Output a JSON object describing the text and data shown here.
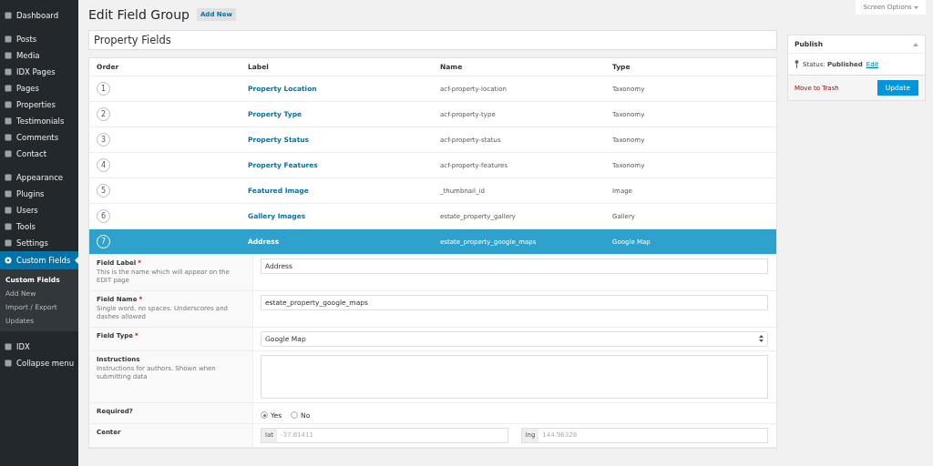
{
  "sidebar": {
    "groups": [
      [
        {
          "label": "Dashboard",
          "selected": false
        }
      ],
      [
        {
          "label": "Posts",
          "selected": false
        },
        {
          "label": "Media",
          "selected": false
        },
        {
          "label": "IDX Pages",
          "selected": false
        },
        {
          "label": "Pages",
          "selected": false
        },
        {
          "label": "Properties",
          "selected": false
        },
        {
          "label": "Testimonials",
          "selected": false
        },
        {
          "label": "Comments",
          "selected": false
        },
        {
          "label": "Contact",
          "selected": false
        }
      ],
      [
        {
          "label": "Appearance",
          "selected": false
        },
        {
          "label": "Plugins",
          "selected": false
        },
        {
          "label": "Users",
          "selected": false
        },
        {
          "label": "Tools",
          "selected": false
        },
        {
          "label": "Settings",
          "selected": false
        },
        {
          "label": "Custom Fields",
          "selected": true,
          "submenu": [
            {
              "label": "Custom Fields",
              "selected": true
            },
            {
              "label": "Add New",
              "selected": false
            },
            {
              "label": "Import / Export",
              "selected": false
            },
            {
              "label": "Updates",
              "selected": false
            }
          ]
        }
      ],
      [
        {
          "label": "IDX",
          "selected": false
        },
        {
          "label": "Collapse menu",
          "selected": false
        }
      ]
    ]
  },
  "screen_options": "Screen Options",
  "page_title": "Edit Field Group",
  "add_new": "Add New",
  "group_title": "Property Fields",
  "table": {
    "columns": [
      "Order",
      "Label",
      "Name",
      "Type"
    ],
    "rows": [
      {
        "order": "1",
        "label": "Property Location",
        "name": "acf-property-location",
        "type": "Taxonomy",
        "selected": false
      },
      {
        "order": "2",
        "label": "Property Type",
        "name": "acf-property-type",
        "type": "Taxonomy",
        "selected": false
      },
      {
        "order": "3",
        "label": "Property Status",
        "name": "acf-property-status",
        "type": "Taxonomy",
        "selected": false
      },
      {
        "order": "4",
        "label": "Property Features",
        "name": "acf-property-features",
        "type": "Taxonomy",
        "selected": false
      },
      {
        "order": "5",
        "label": "Featured Image",
        "name": "_thumbnail_id",
        "type": "Image",
        "selected": false
      },
      {
        "order": "6",
        "label": "Gallery Images",
        "name": "estate_property_gallery",
        "type": "Gallery",
        "selected": false
      },
      {
        "order": "7",
        "label": "Address",
        "name": "estate_property_google_maps",
        "type": "Google Map",
        "selected": true
      }
    ]
  },
  "settings": [
    {
      "kind": "text",
      "label": "Field Label",
      "required_mark": "*",
      "help": "This is the name which will appear on the EDIT page",
      "value": "Address"
    },
    {
      "kind": "text",
      "label": "Field Name",
      "required_mark": "*",
      "help": "Single word, no spaces. Underscores and dashes allowed",
      "value": "estate_property_google_maps"
    },
    {
      "kind": "select",
      "label": "Field Type",
      "required_mark": "*",
      "value": "Google Map"
    },
    {
      "kind": "textarea",
      "label": "Instructions",
      "help": "Instructions for authors. Shown when submitting data"
    },
    {
      "kind": "radio",
      "label": "Required?",
      "options": [
        {
          "label": "Yes",
          "selected": true
        },
        {
          "label": "No",
          "selected": false
        }
      ]
    },
    {
      "kind": "latlng",
      "label": "Center",
      "fields": [
        {
          "prefix": "lat",
          "placeholder": "-37.81411"
        },
        {
          "prefix": "lng",
          "placeholder": "144.96328"
        }
      ]
    }
  ],
  "publish": {
    "title": "Publish",
    "status_label": "Status:",
    "status": "Published",
    "edit": "Edit",
    "trash": "Move to Trash",
    "update": "Update"
  }
}
